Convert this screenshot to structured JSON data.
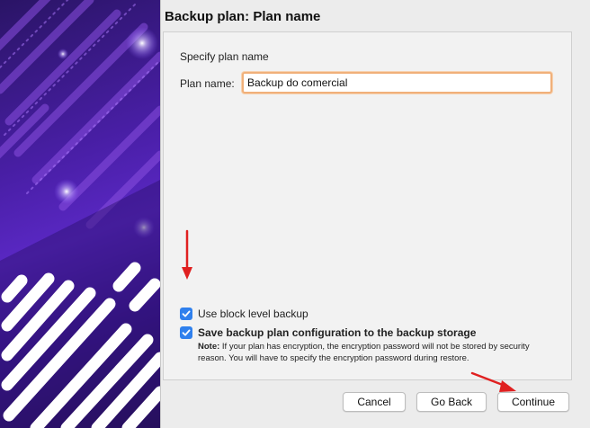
{
  "dialog": {
    "title": "Backup plan: Plan name"
  },
  "plan_name_section": {
    "heading": "Specify plan name",
    "field_label": "Plan name:",
    "field_value": "Backup do comercial"
  },
  "options": {
    "block_level": {
      "label": "Use block level backup",
      "checked": true
    },
    "save_config": {
      "label": "Save backup plan configuration to the backup storage",
      "checked": true
    },
    "note_prefix": "Note:",
    "note_text": " If your plan has encryption, the encryption password will not be stored by security reason. You will have to specify the encryption password during restore."
  },
  "buttons": {
    "cancel": "Cancel",
    "go_back": "Go Back",
    "continue": "Continue"
  },
  "colors": {
    "checkbox": "#2f80ed",
    "annotation_arrow": "#e02020",
    "input_focus": "#f0b07a"
  }
}
